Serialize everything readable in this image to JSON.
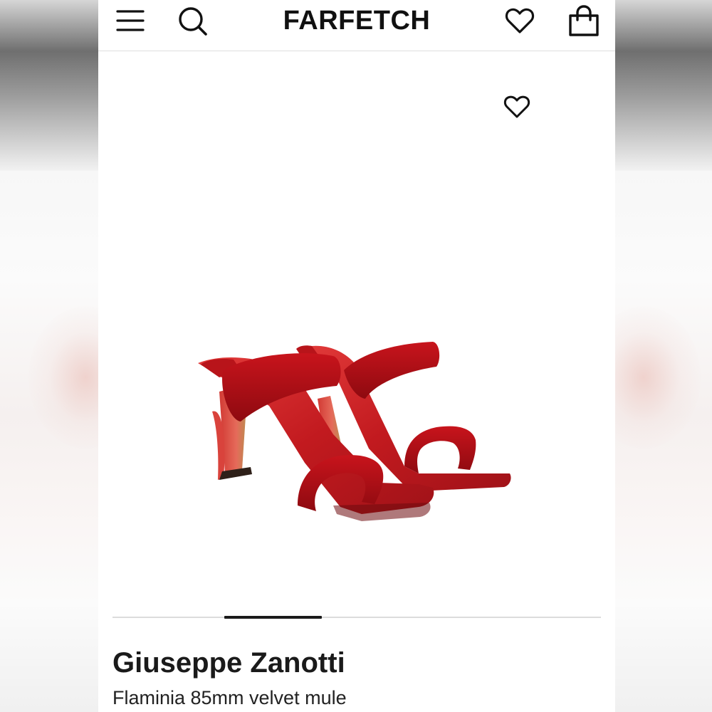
{
  "header": {
    "logo": "FARFETCH",
    "menu_icon": "hamburger-menu-icon",
    "search_icon": "search-icon",
    "wishlist_icon": "heart-icon",
    "bag_icon": "shopping-bag-icon"
  },
  "product": {
    "brand": "Giuseppe Zanotti",
    "name": "Flaminia 85mm velvet mule",
    "wishlist_icon": "heart-icon",
    "gallery": {
      "active_index": 2,
      "accent_color": "#1a1a1a"
    }
  },
  "colors": {
    "text": "#1a1a1a",
    "background": "#ffffff",
    "divider": "#dedede",
    "product_red": "#c8141c"
  }
}
